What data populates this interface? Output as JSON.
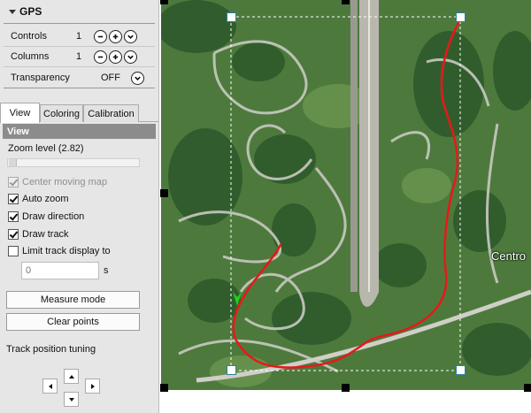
{
  "gps": {
    "title": "GPS",
    "controls": {
      "label": "Controls",
      "value": "1"
    },
    "columns": {
      "label": "Columns",
      "value": "1"
    },
    "transparency": {
      "label": "Transparency",
      "value": "OFF"
    }
  },
  "tabs": [
    {
      "label": "View",
      "active": true
    },
    {
      "label": "Coloring",
      "active": false
    },
    {
      "label": "Calibration",
      "active": false
    }
  ],
  "view": {
    "section_title": "View",
    "zoom_label": "Zoom level (2.82)",
    "options": [
      {
        "label": "Center moving map",
        "checked": true,
        "disabled": true
      },
      {
        "label": "Auto zoom",
        "checked": true,
        "disabled": false
      },
      {
        "label": "Draw direction",
        "checked": true,
        "disabled": false
      },
      {
        "label": "Draw track",
        "checked": true,
        "disabled": false
      },
      {
        "label": "Limit track display to",
        "checked": false,
        "disabled": false
      }
    ],
    "limit_seconds": "0",
    "limit_unit": "s",
    "measure_mode": "Measure mode",
    "clear_points": "Clear points",
    "tuning_label": "Track position tuning"
  },
  "map": {
    "place_label": "Centro",
    "track_color": "#e8181a",
    "direction_color": "#1fd11f",
    "grass_color": "#4f7a3a",
    "road_color": "#c9c9c2"
  }
}
